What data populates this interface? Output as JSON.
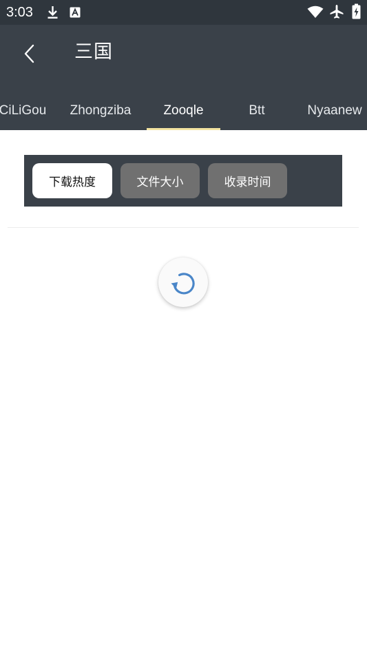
{
  "status_bar": {
    "time": "3:03",
    "icons": [
      "download-icon",
      "text-notification-icon",
      "wifi-icon",
      "airplane-mode-icon",
      "battery-charging-icon"
    ]
  },
  "header": {
    "title": "三国",
    "back_icon": "back-arrow-icon"
  },
  "tabs": [
    {
      "label": "CiLiGou"
    },
    {
      "label": "Zhongziba"
    },
    {
      "label": "Zooqle",
      "active": true
    },
    {
      "label": "Btt"
    },
    {
      "label": "Nyaanew"
    }
  ],
  "sort_options": [
    {
      "label": "下载热度",
      "selected": true
    },
    {
      "label": "文件大小"
    },
    {
      "label": "收录时间"
    }
  ],
  "loading": {
    "icon": "refresh-spinner-icon"
  },
  "colors": {
    "status_bar": "#2f363d",
    "header": "#3a4149",
    "tab_indicator": "#f3e3a0",
    "spinner": "#4a86c8",
    "sort_unselected": "#707070",
    "sort_selected": "#ffffff"
  }
}
